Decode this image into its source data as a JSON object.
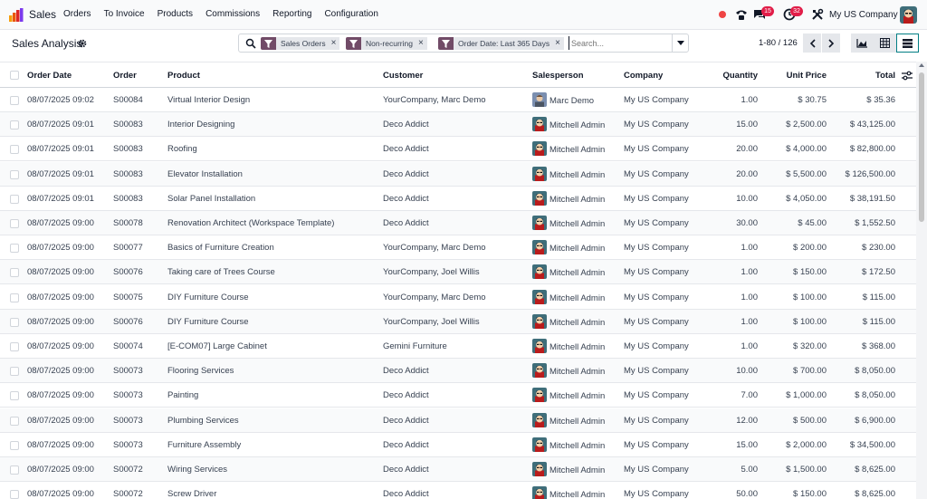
{
  "navbar": {
    "app_name": "Sales",
    "menu": [
      "Orders",
      "To Invoice",
      "Products",
      "Commissions",
      "Reporting",
      "Configuration"
    ],
    "messages_count": "15",
    "activities_count": "32",
    "company": "My US Company"
  },
  "control_panel": {
    "title": "Sales Analysis",
    "facets": [
      "Sales Orders",
      "Non-recurring",
      "Order Date: Last 365 Days"
    ],
    "search_placeholder": "Search...",
    "pager": "1-80 / 126"
  },
  "table": {
    "columns": [
      "Order Date",
      "Order",
      "Product",
      "Customer",
      "Salesperson",
      "Company",
      "Quantity",
      "Unit Price",
      "Total"
    ],
    "rows": [
      {
        "date": "08/07/2025 09:02",
        "order": "S00084",
        "product": "Virtual Interior Design",
        "customer": "YourCompany, Marc Demo",
        "salesperson": "Marc Demo",
        "company": "My US Company",
        "qty": "1.00",
        "price": "$ 30.75",
        "total": "$ 35.36"
      },
      {
        "date": "08/07/2025 09:01",
        "order": "S00083",
        "product": "Interior Designing",
        "customer": "Deco Addict",
        "salesperson": "Mitchell Admin",
        "company": "My US Company",
        "qty": "15.00",
        "price": "$ 2,500.00",
        "total": "$ 43,125.00"
      },
      {
        "date": "08/07/2025 09:01",
        "order": "S00083",
        "product": "Roofing",
        "customer": "Deco Addict",
        "salesperson": "Mitchell Admin",
        "company": "My US Company",
        "qty": "20.00",
        "price": "$ 4,000.00",
        "total": "$ 82,800.00"
      },
      {
        "date": "08/07/2025 09:01",
        "order": "S00083",
        "product": "Elevator Installation",
        "customer": "Deco Addict",
        "salesperson": "Mitchell Admin",
        "company": "My US Company",
        "qty": "20.00",
        "price": "$ 5,500.00",
        "total": "$ 126,500.00"
      },
      {
        "date": "08/07/2025 09:01",
        "order": "S00083",
        "product": "Solar Panel Installation",
        "customer": "Deco Addict",
        "salesperson": "Mitchell Admin",
        "company": "My US Company",
        "qty": "10.00",
        "price": "$ 4,050.00",
        "total": "$ 38,191.50"
      },
      {
        "date": "08/07/2025 09:00",
        "order": "S00078",
        "product": "Renovation Architect (Workspace Template)",
        "customer": "Deco Addict",
        "salesperson": "Mitchell Admin",
        "company": "My US Company",
        "qty": "30.00",
        "price": "$ 45.00",
        "total": "$ 1,552.50"
      },
      {
        "date": "08/07/2025 09:00",
        "order": "S00077",
        "product": "Basics of Furniture Creation",
        "customer": "YourCompany, Marc Demo",
        "salesperson": "Mitchell Admin",
        "company": "My US Company",
        "qty": "1.00",
        "price": "$ 200.00",
        "total": "$ 230.00"
      },
      {
        "date": "08/07/2025 09:00",
        "order": "S00076",
        "product": "Taking care of Trees Course",
        "customer": "YourCompany, Joel Willis",
        "salesperson": "Mitchell Admin",
        "company": "My US Company",
        "qty": "1.00",
        "price": "$ 150.00",
        "total": "$ 172.50"
      },
      {
        "date": "08/07/2025 09:00",
        "order": "S00075",
        "product": "DIY Furniture Course",
        "customer": "YourCompany, Marc Demo",
        "salesperson": "Mitchell Admin",
        "company": "My US Company",
        "qty": "1.00",
        "price": "$ 100.00",
        "total": "$ 115.00"
      },
      {
        "date": "08/07/2025 09:00",
        "order": "S00076",
        "product": "DIY Furniture Course",
        "customer": "YourCompany, Joel Willis",
        "salesperson": "Mitchell Admin",
        "company": "My US Company",
        "qty": "1.00",
        "price": "$ 100.00",
        "total": "$ 115.00"
      },
      {
        "date": "08/07/2025 09:00",
        "order": "S00074",
        "product": "[E-COM07] Large Cabinet",
        "customer": "Gemini Furniture",
        "salesperson": "Mitchell Admin",
        "company": "My US Company",
        "qty": "1.00",
        "price": "$ 320.00",
        "total": "$ 368.00"
      },
      {
        "date": "08/07/2025 09:00",
        "order": "S00073",
        "product": "Flooring Services",
        "customer": "Deco Addict",
        "salesperson": "Mitchell Admin",
        "company": "My US Company",
        "qty": "10.00",
        "price": "$ 700.00",
        "total": "$ 8,050.00"
      },
      {
        "date": "08/07/2025 09:00",
        "order": "S00073",
        "product": "Painting",
        "customer": "Deco Addict",
        "salesperson": "Mitchell Admin",
        "company": "My US Company",
        "qty": "7.00",
        "price": "$ 1,000.00",
        "total": "$ 8,050.00"
      },
      {
        "date": "08/07/2025 09:00",
        "order": "S00073",
        "product": "Plumbing Services",
        "customer": "Deco Addict",
        "salesperson": "Mitchell Admin",
        "company": "My US Company",
        "qty": "12.00",
        "price": "$ 500.00",
        "total": "$ 6,900.00"
      },
      {
        "date": "08/07/2025 09:00",
        "order": "S00073",
        "product": "Furniture Assembly",
        "customer": "Deco Addict",
        "salesperson": "Mitchell Admin",
        "company": "My US Company",
        "qty": "15.00",
        "price": "$ 2,000.00",
        "total": "$ 34,500.00"
      },
      {
        "date": "08/07/2025 09:00",
        "order": "S00072",
        "product": "Wiring Services",
        "customer": "Deco Addict",
        "salesperson": "Mitchell Admin",
        "company": "My US Company",
        "qty": "5.00",
        "price": "$ 1,500.00",
        "total": "$ 8,625.00"
      },
      {
        "date": "08/07/2025 09:00",
        "order": "S00072",
        "product": "Screw Driver",
        "customer": "Deco Addict",
        "salesperson": "Mitchell Admin",
        "company": "My US Company",
        "qty": "50.00",
        "price": "$ 150.00",
        "total": "$ 8,625.00"
      }
    ]
  },
  "colors": {
    "brand": "#714b67",
    "accent": "#017e84",
    "notification": "#e11d48"
  }
}
